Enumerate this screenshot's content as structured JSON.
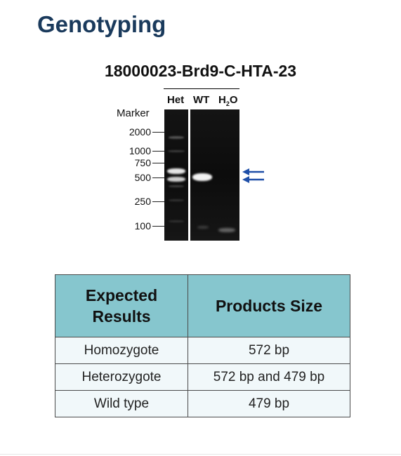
{
  "page": {
    "title": "Genotyping"
  },
  "gel": {
    "title": "18000023-Brd9-C-HTA-23",
    "lanes": [
      "Het",
      "WT",
      "H",
      "2",
      "O"
    ],
    "marker_title": "Marker",
    "marker_labels": [
      "2000",
      "1000",
      "750",
      "500",
      "250",
      "100"
    ]
  },
  "table": {
    "headers": [
      "Expected Results",
      "Products Size"
    ],
    "rows": [
      [
        "Homozygote",
        "572 bp"
      ],
      [
        "Heterozygote",
        "572 bp and 479 bp"
      ],
      [
        "Wild type",
        "479 bp"
      ]
    ]
  },
  "colors": {
    "title": "#1a3a5c",
    "header_bg": "#86c6ce",
    "row_bg": "#f1f8fa",
    "arrow": "#1f4fa8"
  }
}
